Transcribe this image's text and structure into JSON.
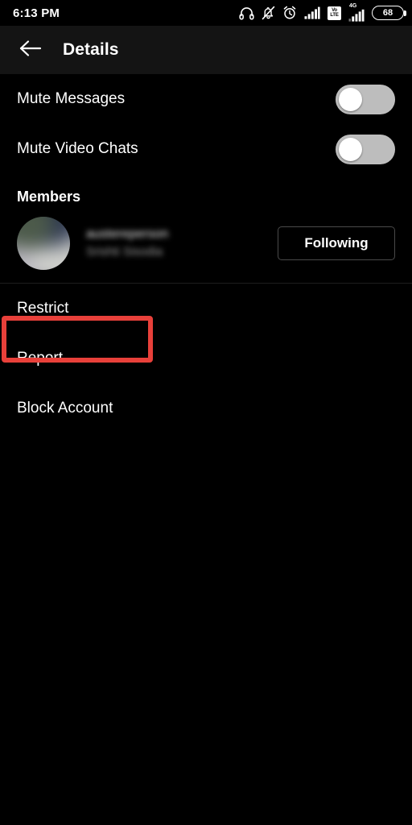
{
  "status_bar": {
    "time": "6:13 PM",
    "icons": [
      {
        "name": "headphones-icon"
      },
      {
        "name": "notifications-muted-icon"
      },
      {
        "name": "alarm-clock-icon"
      },
      {
        "name": "signal-bars-icon"
      },
      {
        "name": "volte-icon",
        "line1": "Vo",
        "line2": "LTE"
      },
      {
        "name": "mobile-data-4g-icon",
        "generation": "4G"
      },
      {
        "name": "battery-icon",
        "level": "68"
      }
    ]
  },
  "app_bar": {
    "back_label": "back-arrow",
    "title": "Details"
  },
  "settings": {
    "toggles": [
      {
        "label": "Mute Messages",
        "state": "off"
      },
      {
        "label": "Mute Video Chats",
        "state": "off"
      }
    ]
  },
  "members": {
    "heading": "Members",
    "list": [
      {
        "username": "austereperson",
        "display_name": "Srishti Sisodia",
        "redacted": true,
        "action_label": "Following"
      }
    ]
  },
  "actions": [
    {
      "label": "Restrict",
      "highlighted": true
    },
    {
      "label": "Report…",
      "highlighted": false
    },
    {
      "label": "Block Account",
      "highlighted": false
    }
  ],
  "colors": {
    "background": "#000000",
    "app_bar": "#141414",
    "highlight_red": "#e8403a",
    "toggle_track_off": "#bdbdbd",
    "toggle_knob": "#ffffff",
    "text_primary": "#ffffff",
    "text_secondary": "#9b9b9b",
    "border": "#4a4a4a"
  }
}
